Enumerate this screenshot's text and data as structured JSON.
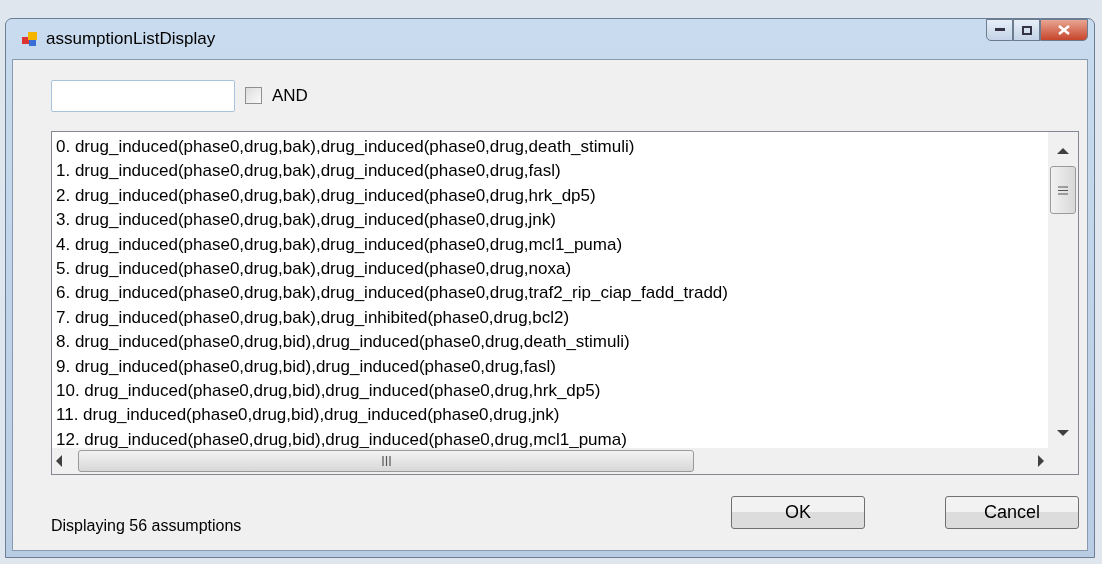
{
  "window": {
    "title": "assumptionListDisplay"
  },
  "filter": {
    "and_label": "AND",
    "and_checked": false
  },
  "items": [
    "0. drug_induced(phase0,drug,bak),drug_induced(phase0,drug,death_stimuli)",
    "1. drug_induced(phase0,drug,bak),drug_induced(phase0,drug,fasl)",
    "2. drug_induced(phase0,drug,bak),drug_induced(phase0,drug,hrk_dp5)",
    "3. drug_induced(phase0,drug,bak),drug_induced(phase0,drug,jnk)",
    "4. drug_induced(phase0,drug,bak),drug_induced(phase0,drug,mcl1_puma)",
    "5. drug_induced(phase0,drug,bak),drug_induced(phase0,drug,noxa)",
    "6. drug_induced(phase0,drug,bak),drug_induced(phase0,drug,traf2_rip_ciap_fadd_tradd)",
    "7. drug_induced(phase0,drug,bak),drug_inhibited(phase0,drug,bcl2)",
    "8. drug_induced(phase0,drug,bid),drug_induced(phase0,drug,death_stimuli)",
    "9. drug_induced(phase0,drug,bid),drug_induced(phase0,drug,fasl)",
    "10. drug_induced(phase0,drug,bid),drug_induced(phase0,drug,hrk_dp5)",
    "11. drug_induced(phase0,drug,bid),drug_induced(phase0,drug,jnk)",
    "12. drug_induced(phase0,drug,bid),drug_induced(phase0,drug,mcl1_puma)"
  ],
  "status": "Displaying 56 assumptions",
  "buttons": [
    "OK",
    "Cancel"
  ]
}
